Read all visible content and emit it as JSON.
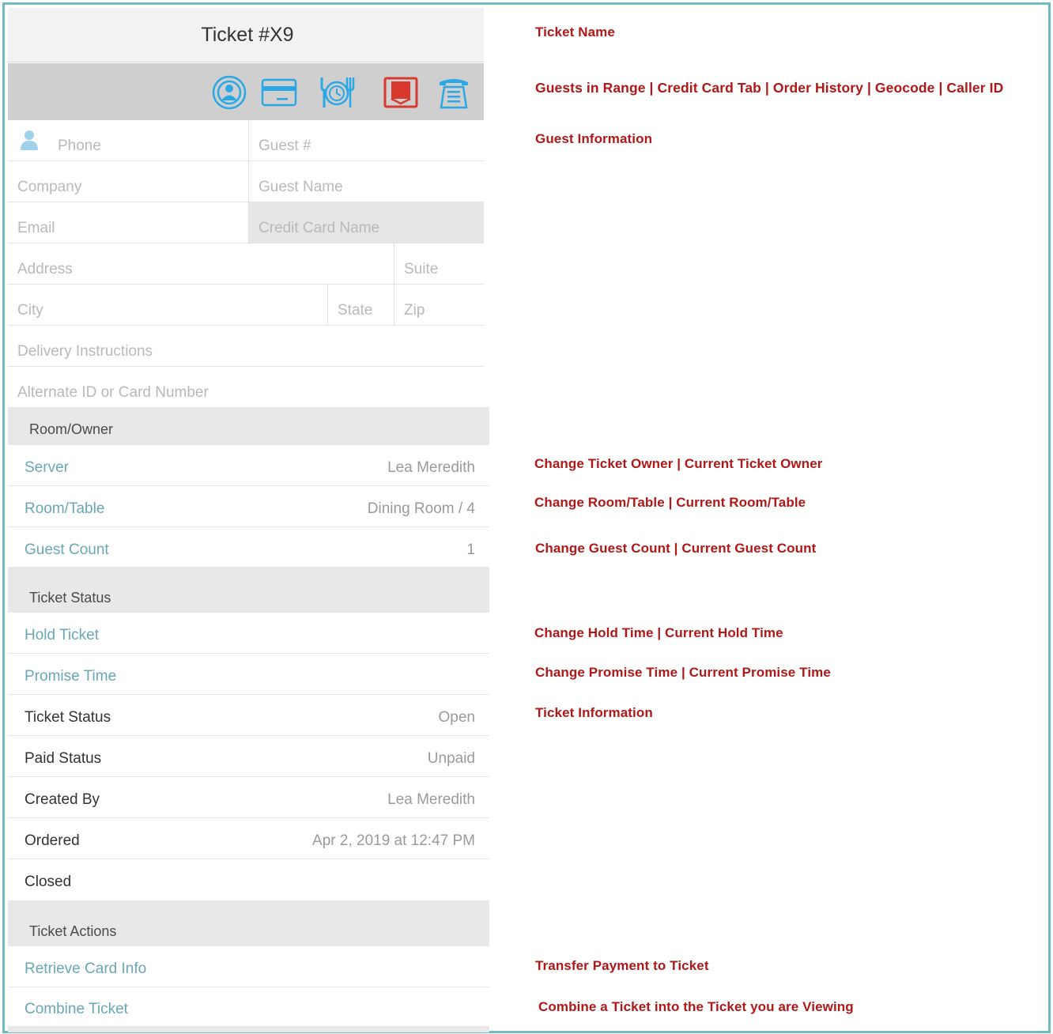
{
  "ticket": {
    "title": "Ticket #X9"
  },
  "toolbar": {
    "icons": [
      "guests-in-range-icon",
      "credit-card-icon",
      "order-history-icon",
      "geocode-icon",
      "caller-id-icon"
    ],
    "colors": {
      "blue": "#2aa8e6",
      "red": "#d9382c"
    }
  },
  "guest": {
    "phone_placeholder": "Phone",
    "guest_number_placeholder": "Guest #",
    "company_placeholder": "Company",
    "guest_name_placeholder": "Guest Name",
    "email_placeholder": "Email",
    "credit_card_name_placeholder": "Credit Card Name",
    "address_placeholder": "Address",
    "suite_placeholder": "Suite",
    "city_placeholder": "City",
    "state_placeholder": "State",
    "zip_placeholder": "Zip",
    "delivery_placeholder": "Delivery Instructions",
    "alternate_id_placeholder": "Alternate ID or Card Number"
  },
  "room_owner": {
    "header": "Room/Owner",
    "rows": [
      {
        "label": "Server",
        "value": "Lea Meredith"
      },
      {
        "label": "Room/Table",
        "value": "Dining Room / 4"
      },
      {
        "label": "Guest Count",
        "value": "1"
      }
    ]
  },
  "ticket_status": {
    "header": "Ticket Status",
    "rows": [
      {
        "label": "Hold Ticket",
        "value": ""
      },
      {
        "label": "Promise Time",
        "value": ""
      },
      {
        "label": "Ticket Status",
        "value": "Open"
      },
      {
        "label": "Paid Status",
        "value": "Unpaid"
      },
      {
        "label": "Created By",
        "value": "Lea Meredith"
      },
      {
        "label": "Ordered",
        "value": "Apr 2, 2019 at 12:47 PM"
      },
      {
        "label": "Closed",
        "value": ""
      }
    ]
  },
  "ticket_actions": {
    "header": "Ticket Actions",
    "rows": [
      {
        "label": "Retrieve Card Info"
      },
      {
        "label": "Combine Ticket"
      }
    ]
  },
  "annotations": {
    "ticket_name": "Ticket Name",
    "toolbar": "Guests in Range | Credit Card Tab | Order History | Geocode | Caller ID",
    "guest_info": "Guest Information",
    "owner": "Change Ticket Owner | Current Ticket Owner",
    "room": "Change Room/Table | Current Room/Table",
    "guest_count": "Change Guest Count | Current Guest Count",
    "hold": "Change Hold Time | Current Hold Time",
    "promise": "Change Promise Time | Current Promise Time",
    "ticket_info": "Ticket Information",
    "transfer": "Transfer Payment to Ticket",
    "combine": "Combine a Ticket into the Ticket you are Viewing"
  }
}
